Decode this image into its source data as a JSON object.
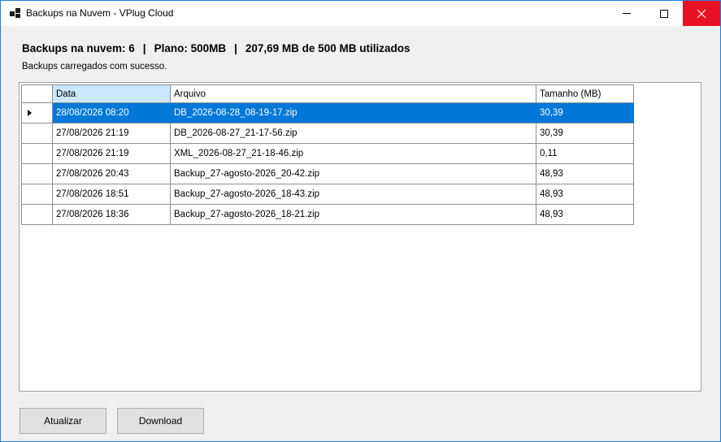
{
  "window": {
    "title": "Backups na Nuvem - VPlug Cloud"
  },
  "summary": {
    "count_text": "Backups na nuvem: 6",
    "plan_text": "Plano: 500MB",
    "usage_text": "207,69 MB de 500 MB utilizados",
    "separator": "|"
  },
  "status_text": "Backups carregados com sucesso.",
  "grid": {
    "columns": [
      "Data",
      "Arquivo",
      "Tamanho (MB)"
    ],
    "selected_row": 0,
    "rows": [
      {
        "data": "28/08/2026 08:20",
        "arquivo": "DB_2026-08-28_08-19-17.zip",
        "tamanho": "30,39"
      },
      {
        "data": "27/08/2026 21:19",
        "arquivo": "DB_2026-08-27_21-17-56.zip",
        "tamanho": "30,39"
      },
      {
        "data": "27/08/2026 21:19",
        "arquivo": "XML_2026-08-27_21-18-46.zip",
        "tamanho": "0,11"
      },
      {
        "data": "27/08/2026 20:43",
        "arquivo": "Backup_27-agosto-2026_20-42.zip",
        "tamanho": "48,93"
      },
      {
        "data": "27/08/2026 18:51",
        "arquivo": "Backup_27-agosto-2026_18-43.zip",
        "tamanho": "48,93"
      },
      {
        "data": "27/08/2026 18:36",
        "arquivo": "Backup_27-agosto-2026_18-21.zip",
        "tamanho": "48,93"
      }
    ]
  },
  "buttons": {
    "refresh_label": "Atualizar",
    "download_label": "Download"
  },
  "colors": {
    "selection": "#0078d7",
    "close_button": "#e81123",
    "header_highlight": "#cce8ff"
  },
  "icons": {
    "app": "app-window-icon",
    "minimize": "minimize-icon",
    "maximize": "maximize-icon",
    "close": "close-icon",
    "row_indicator": "row-pointer-icon"
  }
}
